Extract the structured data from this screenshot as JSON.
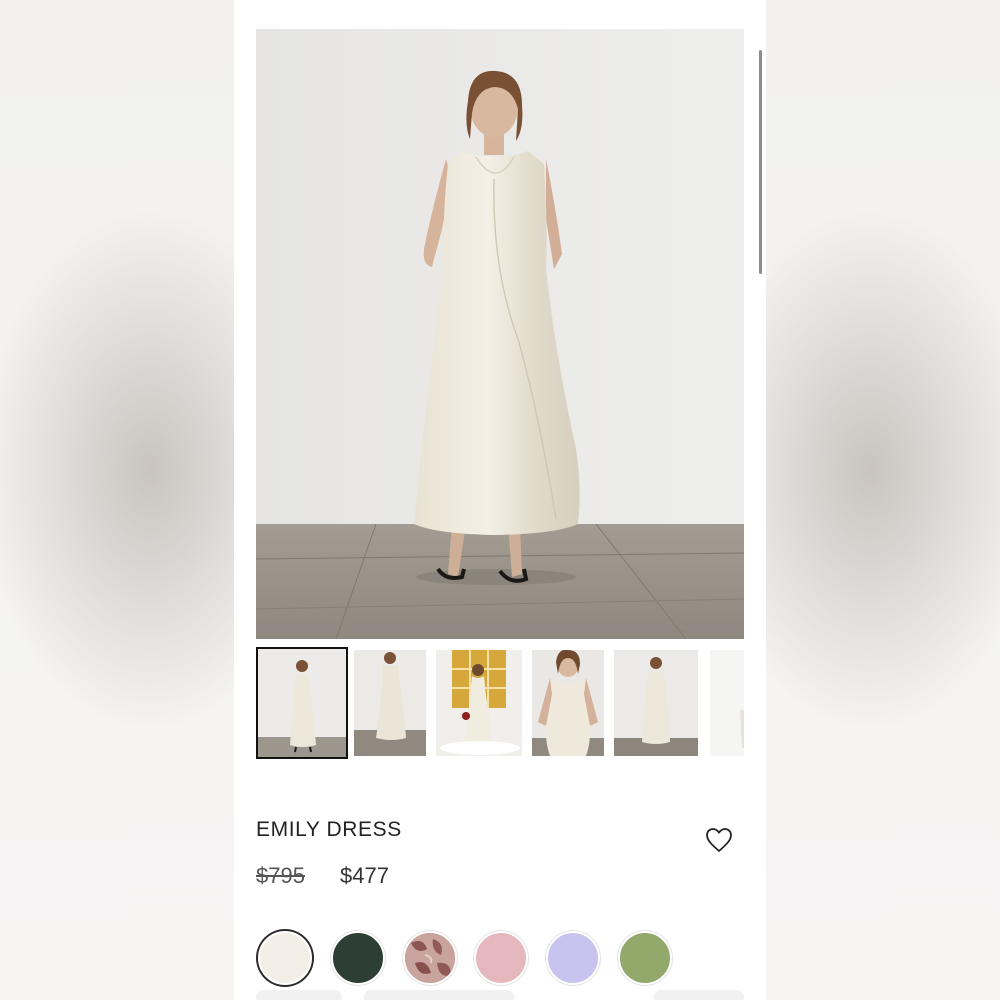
{
  "product": {
    "name": "EMILY DRESS",
    "original_price": "$795",
    "sale_price": "$477"
  },
  "gallery": {
    "thumbnails": [
      {
        "label": "front view full length",
        "selected": true
      },
      {
        "label": "side view"
      },
      {
        "label": "styled with bouquet"
      },
      {
        "label": "close-up neckline"
      },
      {
        "label": "back view"
      },
      {
        "label": "partial next image"
      }
    ]
  },
  "colors": {
    "swatches": [
      {
        "name": "ivory",
        "color": "#f3efe6",
        "selected": true
      },
      {
        "name": "dark green",
        "color": "#2d3e34"
      },
      {
        "name": "pink floral",
        "color": "#c7958f"
      },
      {
        "name": "blush pink",
        "color": "#e4b8bc"
      },
      {
        "name": "lavender",
        "color": "#c9c3ef"
      },
      {
        "name": "sage green",
        "color": "#93a86b"
      }
    ]
  },
  "icons": {
    "wishlist": "heart-icon"
  }
}
